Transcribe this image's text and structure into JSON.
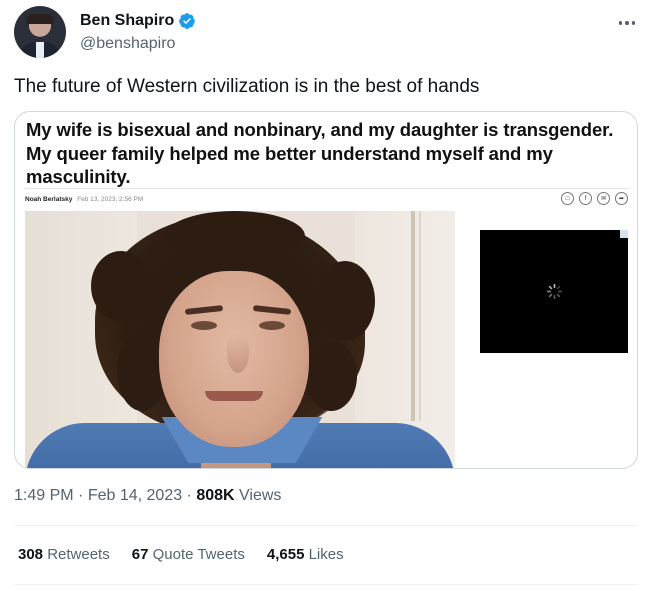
{
  "author": {
    "name": "Ben Shapiro",
    "handle": "@benshapiro",
    "verified_color": "#1d9bf0"
  },
  "tweet": {
    "text": "The future of Western civilization is in the best of hands"
  },
  "embedded_article": {
    "headline": "My wife is bisexual and nonbinary, and my daughter is transgender. My queer family helped me better understand myself and my masculinity.",
    "byline_author": "Noah Berlatsky",
    "byline_date": "Feb 13, 2023, 2:56 PM",
    "share_icons": [
      "bookmark-icon",
      "facebook-icon",
      "email-icon",
      "share-icon"
    ]
  },
  "meta": {
    "time": "1:49 PM",
    "separator": " · ",
    "date": "Feb 14, 2023",
    "views_count": "808K",
    "views_label": " Views"
  },
  "stats": {
    "retweets_count": "308",
    "retweets_label": " Retweets",
    "quotes_count": "67",
    "quotes_label": " Quote Tweets",
    "likes_count": "4,655",
    "likes_label": " Likes"
  }
}
